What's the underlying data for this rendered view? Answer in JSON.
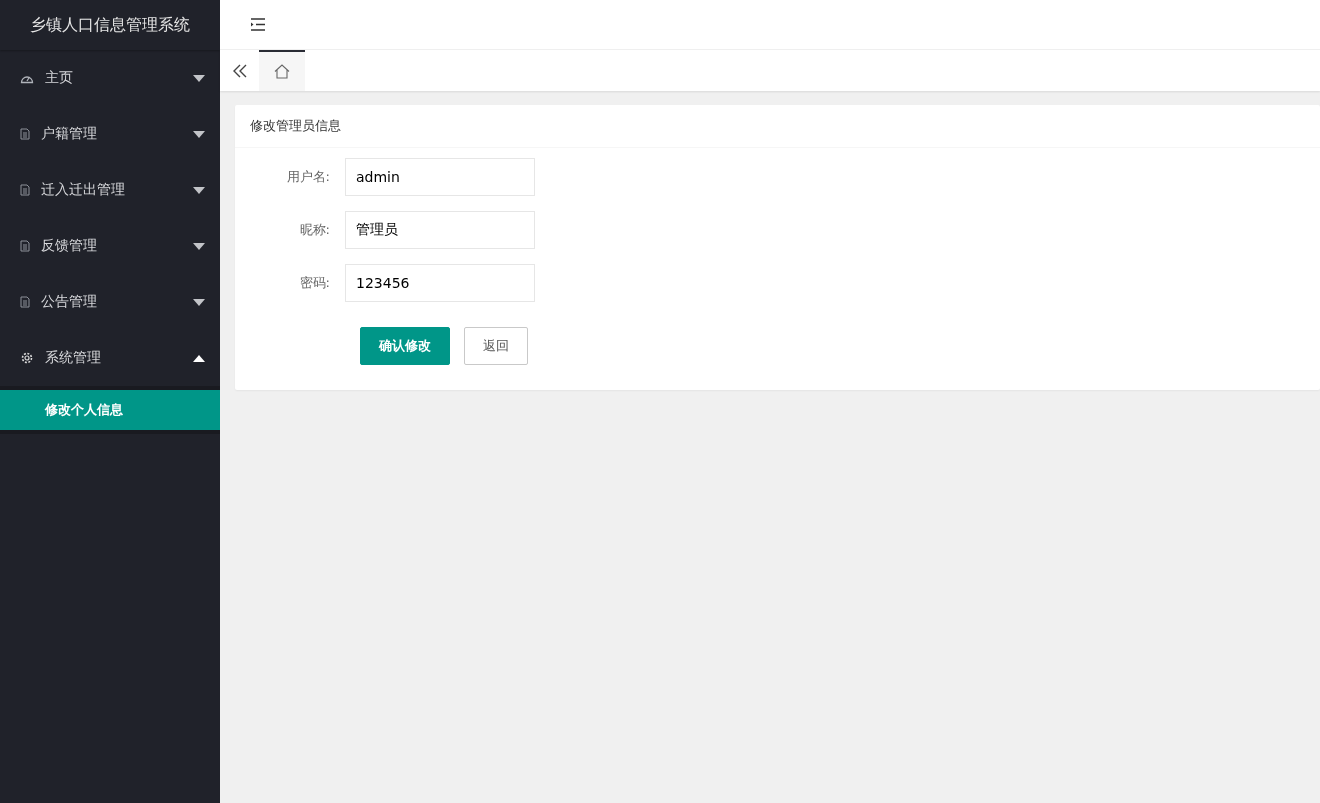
{
  "app": {
    "title": "乡镇人口信息管理系统"
  },
  "sidebar": {
    "items": [
      {
        "label": "主页",
        "kind": "home",
        "expanded": false
      },
      {
        "label": "户籍管理",
        "kind": "module",
        "expanded": false
      },
      {
        "label": "迁入迁出管理",
        "kind": "module",
        "expanded": false
      },
      {
        "label": "反馈管理",
        "kind": "module",
        "expanded": false
      },
      {
        "label": "公告管理",
        "kind": "module",
        "expanded": false
      },
      {
        "label": "系统管理",
        "kind": "system",
        "expanded": true,
        "children": [
          {
            "label": "修改个人信息",
            "selected": true
          }
        ]
      }
    ]
  },
  "tabs": [
    {
      "kind": "home",
      "selected": true
    }
  ],
  "form": {
    "title": "修改管理员信息",
    "fields": [
      {
        "label": "用户名:",
        "value": "admin"
      },
      {
        "label": "昵称:",
        "value": "管理员"
      },
      {
        "label": "密码:",
        "value": "123456"
      }
    ],
    "buttons": [
      {
        "label": "确认修改",
        "kind": "primary"
      },
      {
        "label": "返回",
        "kind": "default"
      }
    ]
  }
}
